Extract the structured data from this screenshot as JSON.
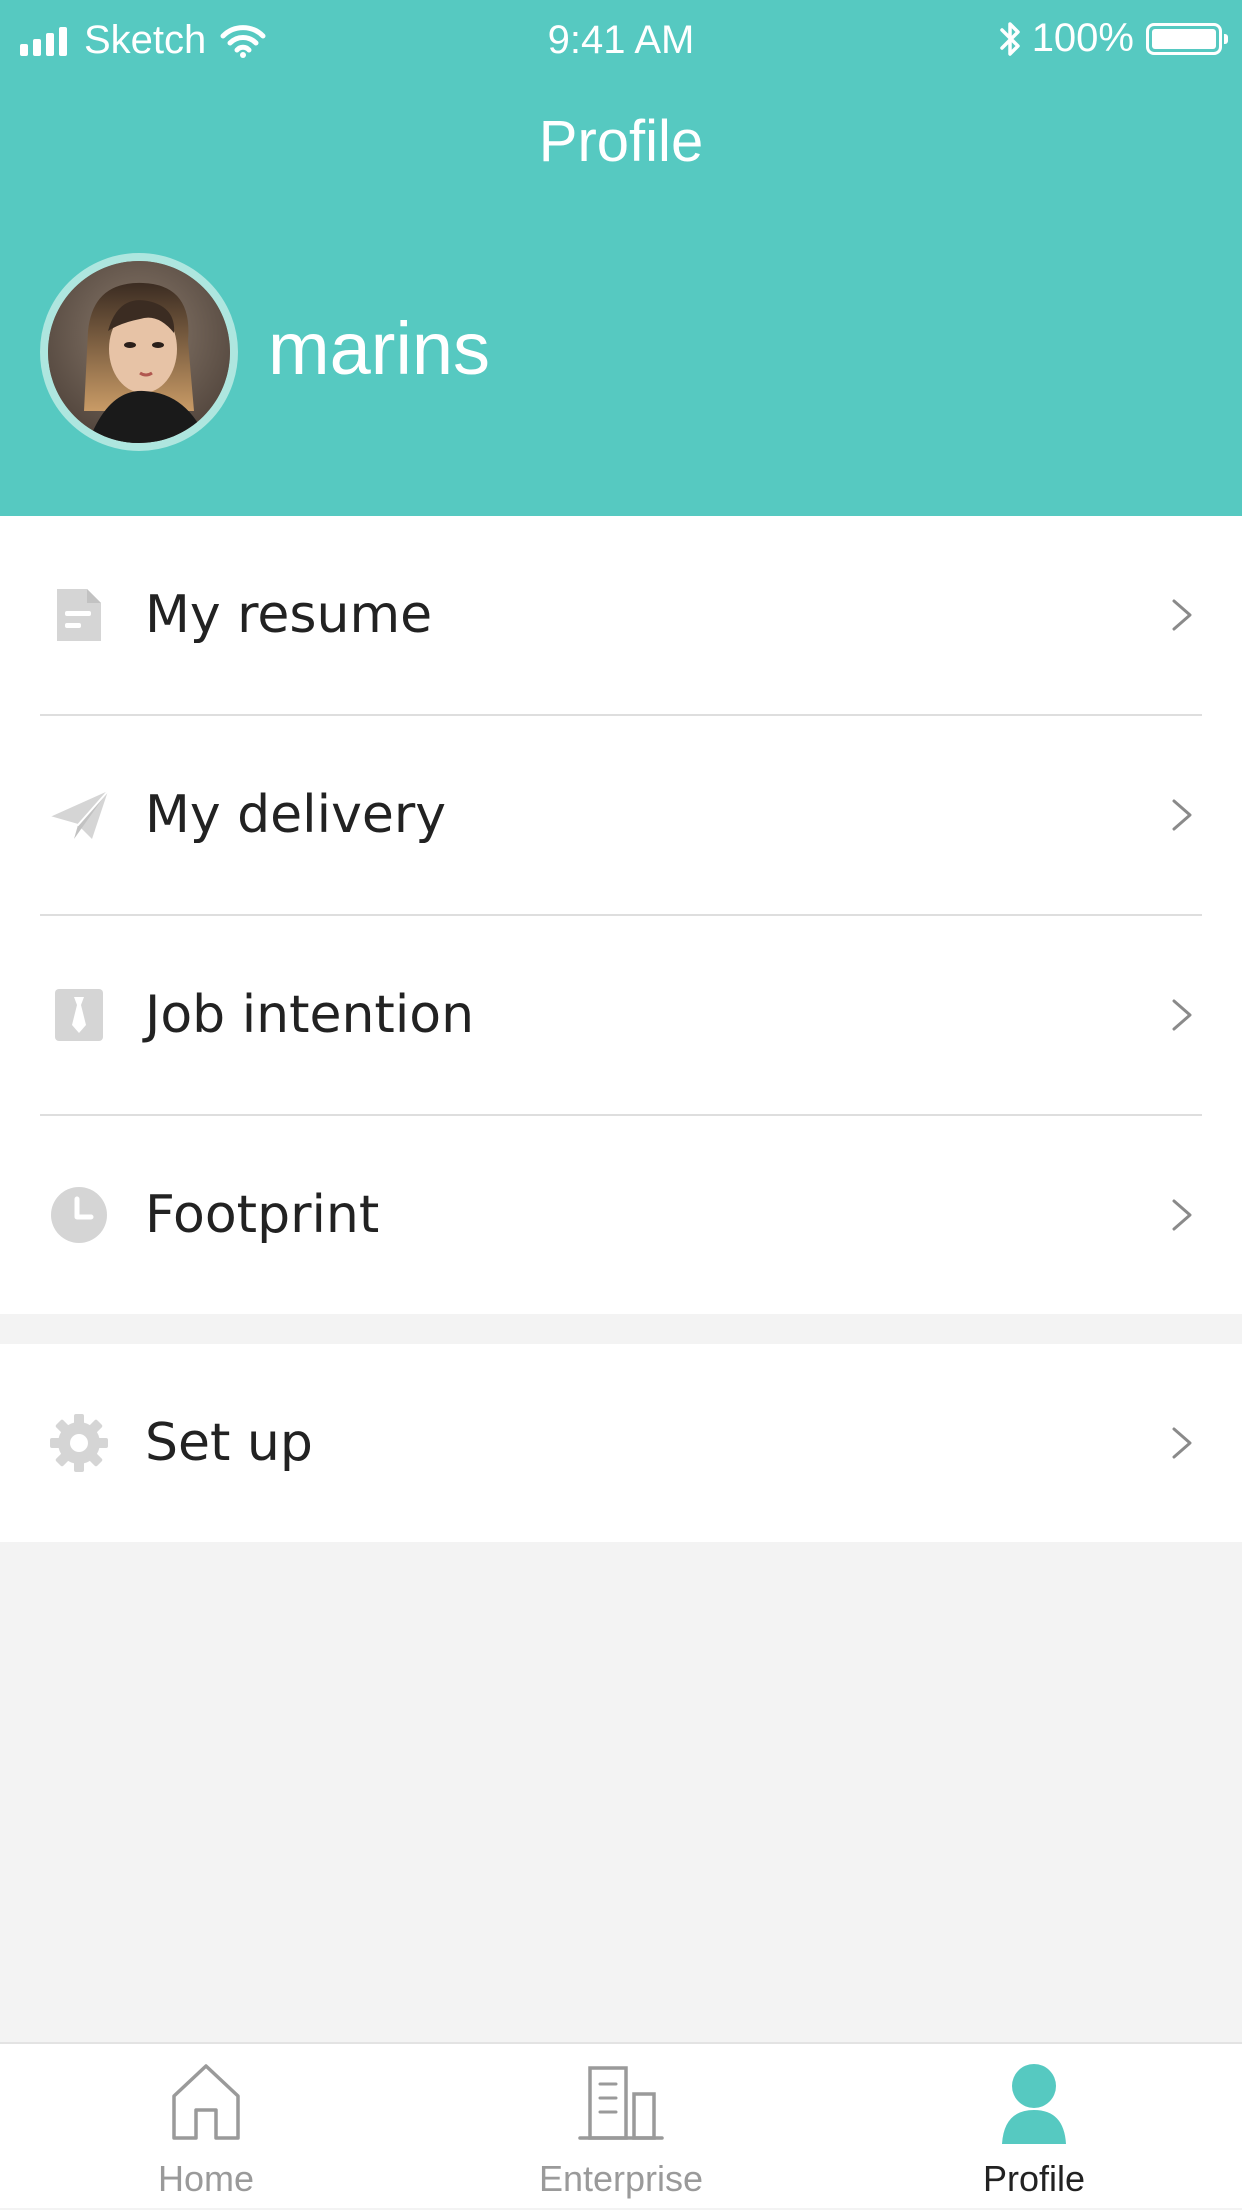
{
  "status_bar": {
    "carrier": "Sketch",
    "time": "9:41 AM",
    "battery": "100%"
  },
  "header": {
    "title": "Profile",
    "username": "marins"
  },
  "menu": {
    "items": [
      {
        "label": "My resume",
        "icon": "document-icon"
      },
      {
        "label": "My delivery",
        "icon": "paper-plane-icon"
      },
      {
        "label": "Job intention",
        "icon": "tie-icon"
      },
      {
        "label": "Footprint",
        "icon": "clock-icon"
      }
    ],
    "settings": {
      "label": "Set up",
      "icon": "gear-icon"
    }
  },
  "tab_bar": {
    "tabs": [
      {
        "label": "Home",
        "icon": "home-icon",
        "active": false
      },
      {
        "label": "Enterprise",
        "icon": "building-icon",
        "active": false
      },
      {
        "label": "Profile",
        "icon": "person-icon",
        "active": true
      }
    ]
  },
  "colors": {
    "accent": "#56c9c1",
    "background": "#f3f3f3",
    "icon_gray": "#d5d5d5",
    "tab_inactive": "#9a9a9a"
  }
}
